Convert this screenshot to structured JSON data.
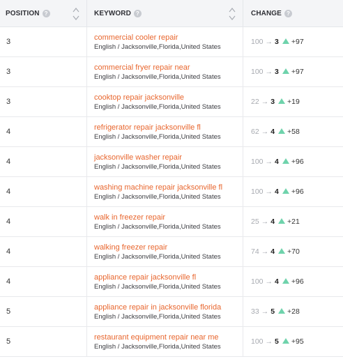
{
  "header": {
    "position_label": "POSITION",
    "keyword_label": "KEYWORD",
    "change_label": "CHANGE",
    "help_glyph": "?"
  },
  "rows": [
    {
      "position": "3",
      "keyword": "commercial cooler repair",
      "location": "English / Jacksonville,Florida,United States",
      "from": "100",
      "to": "3",
      "delta": "+97"
    },
    {
      "position": "3",
      "keyword": "commercial fryer repair near",
      "location": "English / Jacksonville,Florida,United States",
      "from": "100",
      "to": "3",
      "delta": "+97"
    },
    {
      "position": "3",
      "keyword": "cooktop repair jacksonville",
      "location": "English / Jacksonville,Florida,United States",
      "from": "22",
      "to": "3",
      "delta": "+19"
    },
    {
      "position": "4",
      "keyword": "refrigerator repair jacksonville fl",
      "location": "English / Jacksonville,Florida,United States",
      "from": "62",
      "to": "4",
      "delta": "+58"
    },
    {
      "position": "4",
      "keyword": "jacksonville washer repair",
      "location": "English / Jacksonville,Florida,United States",
      "from": "100",
      "to": "4",
      "delta": "+96"
    },
    {
      "position": "4",
      "keyword": "washing machine repair jacksonville fl",
      "location": "English / Jacksonville,Florida,United States",
      "from": "100",
      "to": "4",
      "delta": "+96"
    },
    {
      "position": "4",
      "keyword": "walk in freezer repair",
      "location": "English / Jacksonville,Florida,United States",
      "from": "25",
      "to": "4",
      "delta": "+21"
    },
    {
      "position": "4",
      "keyword": "walking freezer repair",
      "location": "English / Jacksonville,Florida,United States",
      "from": "74",
      "to": "4",
      "delta": "+70"
    },
    {
      "position": "4",
      "keyword": "appliance repair jacksonville fl",
      "location": "English / Jacksonville,Florida,United States",
      "from": "100",
      "to": "4",
      "delta": "+96"
    },
    {
      "position": "5",
      "keyword": "appliance repair in jacksonville florida",
      "location": "English / Jacksonville,Florida,United States",
      "from": "33",
      "to": "5",
      "delta": "+28"
    },
    {
      "position": "5",
      "keyword": "restaurant equipment repair near me",
      "location": "English / Jacksonville,Florida,United States",
      "from": "100",
      "to": "5",
      "delta": "+95"
    }
  ],
  "icons": {
    "help": "question-circle-icon",
    "sort": "sort-up-down-icon",
    "arrow": "right-arrow-icon",
    "up": "triangle-up-icon"
  },
  "colors": {
    "keyword_link": "#e8662e",
    "up_indicator": "#6fd3ac",
    "header_bg": "#f4f5f7"
  }
}
